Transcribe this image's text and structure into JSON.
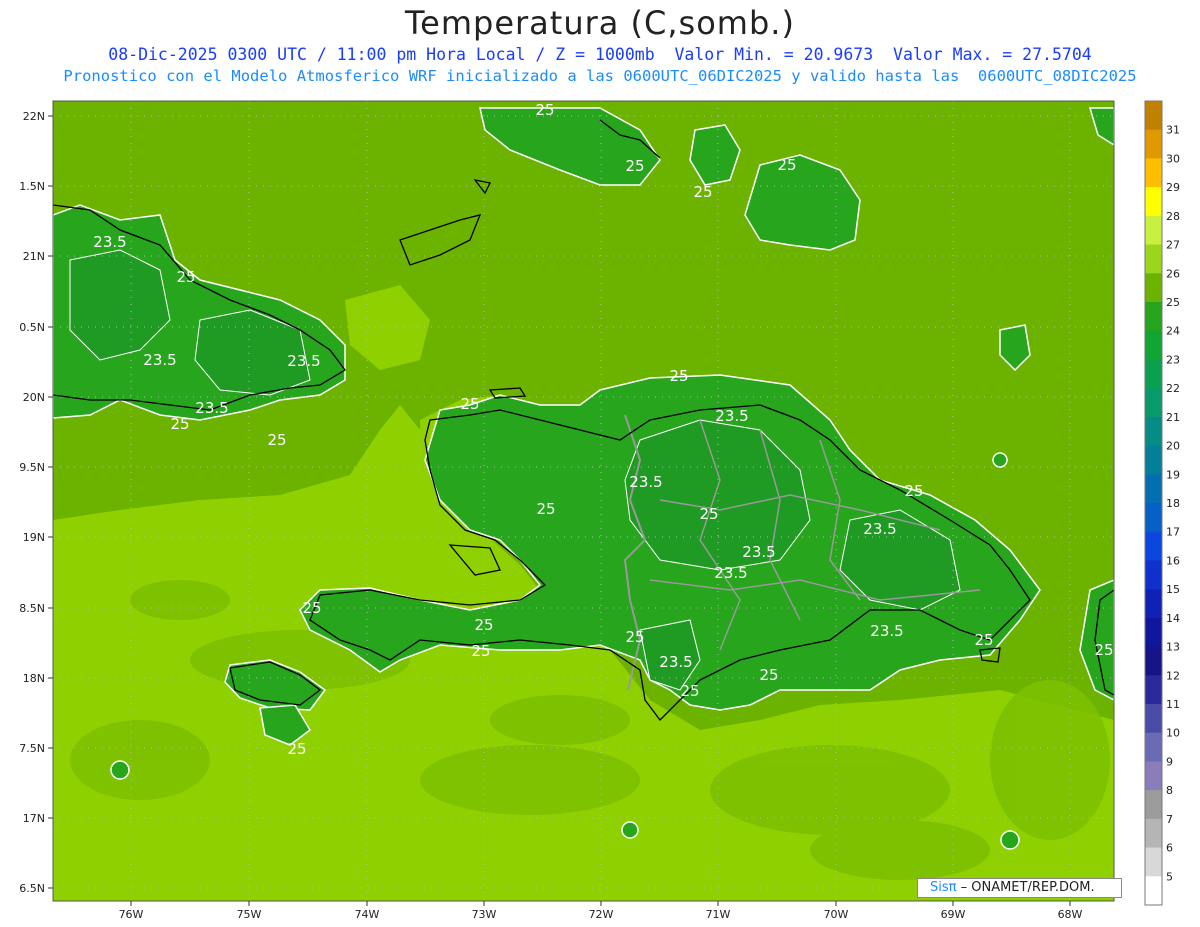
{
  "header": {
    "title": "Temperatura (C,somb.)",
    "subtitle_line1": "08-Dic-2025 0300 UTC / 11:00 pm Hora Local / Z = 1000mb  Valor Min. = 20.9673  Valor Max. = 27.5704",
    "subtitle_line2": "Pronostico con el Modelo Atmosferico WRF inicializado a las 0600UTC_06DIC2025 y valido hasta las  0600UTC_08DIC2025"
  },
  "map": {
    "lat_labels": [
      "22N",
      "1.5N",
      "21N",
      "0.5N",
      "20N",
      "9.5N",
      "19N",
      "8.5N",
      "18N",
      "7.5N",
      "17N",
      "6.5N"
    ],
    "lon_labels": [
      "76W",
      "75W",
      "74W",
      "73W",
      "72W",
      "71W",
      "70W",
      "69W",
      "68W"
    ],
    "contour_labels": [
      "25",
      "25",
      "25",
      "23.5",
      "25",
      "23.5",
      "23.5",
      "25",
      "25",
      "25",
      "25",
      "23.5",
      "23.5",
      "25",
      "25",
      "23.5",
      "25",
      "23.5",
      "23.5",
      "23.5",
      "25",
      "25",
      "25",
      "25",
      "25",
      "23.5",
      "25",
      "25",
      "25",
      "25",
      "25"
    ],
    "colors": {
      "c24_25": "#26a51d",
      "c25_26": "#6cb300",
      "c26_27": "#8fd100",
      "contour": "#ffffff",
      "coast": "#000000",
      "border": "#999999"
    }
  },
  "colorbar": {
    "levels": [
      "31",
      "30",
      "29",
      "28",
      "27",
      "26",
      "25",
      "24",
      "23",
      "22",
      "21",
      "20",
      "19",
      "18",
      "17",
      "16",
      "15",
      "14",
      "13",
      "12",
      "11",
      "10",
      "9",
      "8",
      "7",
      "6",
      "5"
    ],
    "colors": [
      "#c08000",
      "#e09a00",
      "#ffbf00",
      "#ffff00",
      "#c8f040",
      "#9bd61c",
      "#6cb300",
      "#26a51d",
      "#11a532",
      "#0aa050",
      "#079a6a",
      "#068c85",
      "#047f99",
      "#036fb0",
      "#0560c8",
      "#0a48dd",
      "#1030cc",
      "#1022b5",
      "#10169e",
      "#151488",
      "#2a2a9a",
      "#4b4ba8",
      "#6b6bb5",
      "#8a7dba",
      "#9c9c9c",
      "#b5b5b5",
      "#d8d8d8",
      "#ffffff"
    ]
  },
  "credit": {
    "sis": "Sisπ",
    "org": " – ONAMET/REP.DOM."
  }
}
